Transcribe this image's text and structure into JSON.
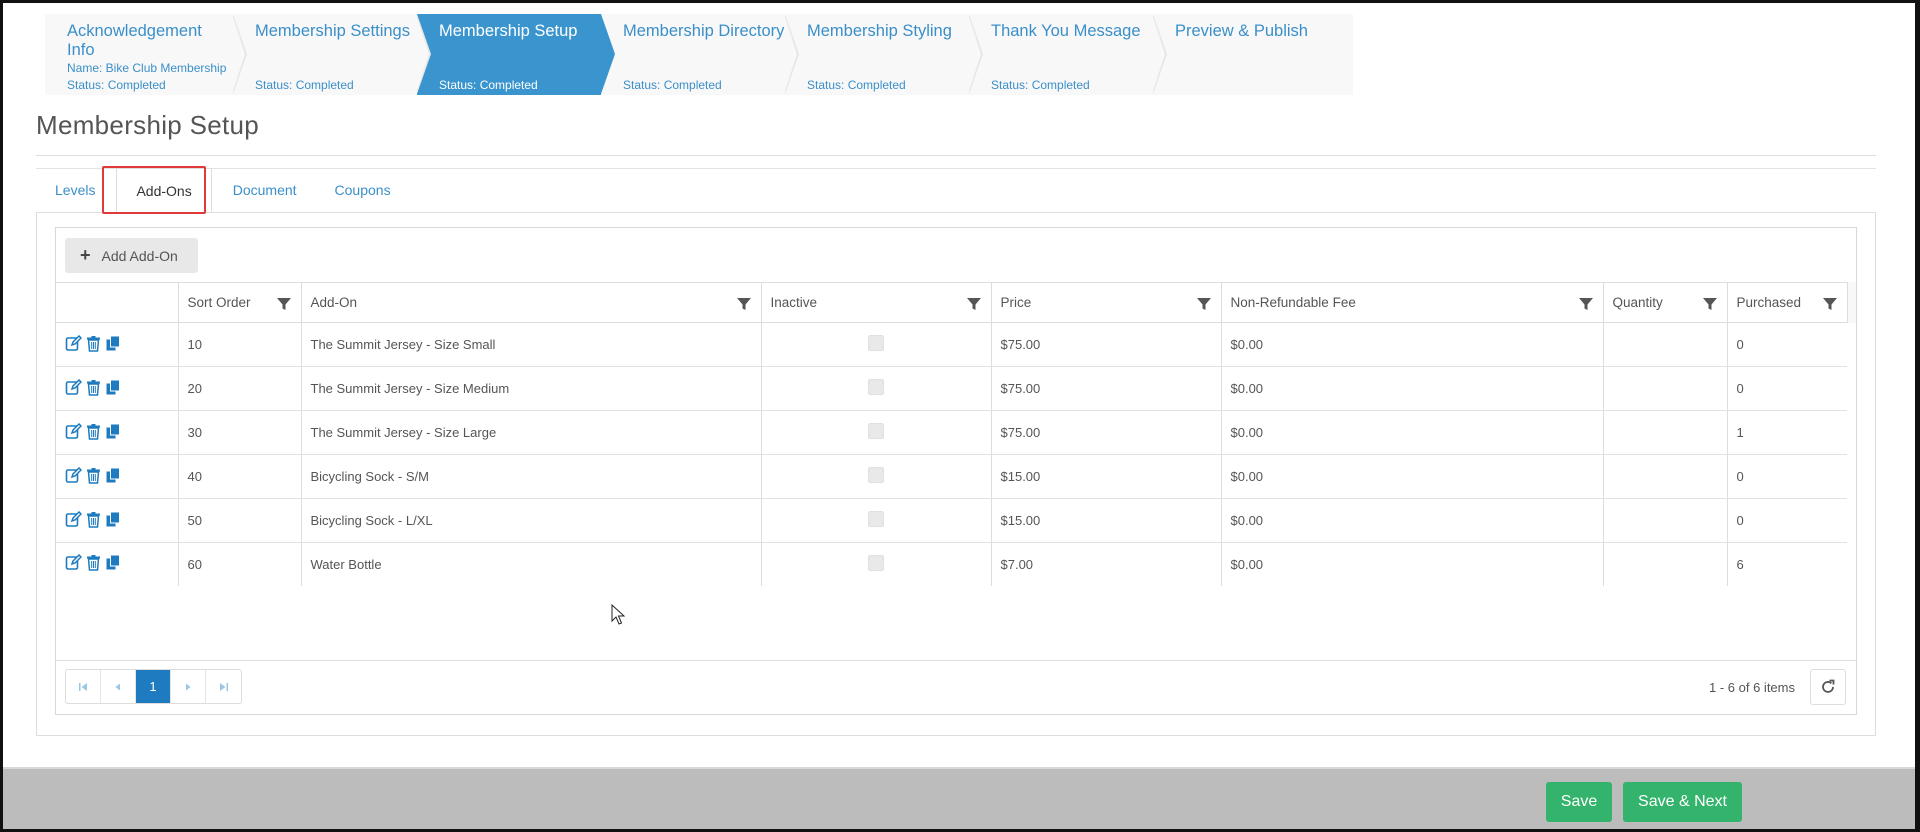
{
  "wizard": {
    "steps": [
      {
        "title": "Acknowledgement Info",
        "name": "Name: Bike Club Membership",
        "status": "Status: Completed",
        "active": false
      },
      {
        "title": "Membership Settings",
        "name": "",
        "status": "Status: Completed",
        "active": false
      },
      {
        "title": "Membership Setup",
        "name": "",
        "status": "Status: Completed",
        "active": true
      },
      {
        "title": "Membership Directory",
        "name": "",
        "status": "Status: Completed",
        "active": false
      },
      {
        "title": "Membership Styling",
        "name": "",
        "status": "Status: Completed",
        "active": false
      },
      {
        "title": "Thank You Message",
        "name": "",
        "status": "Status: Completed",
        "active": false
      },
      {
        "title": "Preview & Publish",
        "name": "",
        "status": "",
        "active": false
      }
    ]
  },
  "page": {
    "title": "Membership Setup"
  },
  "tabs": [
    {
      "label": "Levels",
      "active": false
    },
    {
      "label": "Add-Ons",
      "active": true
    },
    {
      "label": "Document",
      "active": false
    },
    {
      "label": "Coupons",
      "active": false
    }
  ],
  "toolbar": {
    "add_label": "Add Add-On",
    "add_icon": "plus-icon"
  },
  "grid": {
    "columns": [
      "",
      "Sort Order",
      "Add-On",
      "Inactive",
      "Price",
      "Non-Refundable Fee",
      "Quantity",
      "Purchased"
    ],
    "rows": [
      {
        "sort": "10",
        "addon": "The Summit Jersey - Size Small",
        "inactive": false,
        "price": "$75.00",
        "fee": "$0.00",
        "quantity": "",
        "purchased": "0"
      },
      {
        "sort": "20",
        "addon": "The Summit Jersey - Size Medium",
        "inactive": false,
        "price": "$75.00",
        "fee": "$0.00",
        "quantity": "",
        "purchased": "0"
      },
      {
        "sort": "30",
        "addon": "The Summit Jersey - Size Large",
        "inactive": false,
        "price": "$75.00",
        "fee": "$0.00",
        "quantity": "",
        "purchased": "1"
      },
      {
        "sort": "40",
        "addon": "Bicycling Sock - S/M",
        "inactive": false,
        "price": "$15.00",
        "fee": "$0.00",
        "quantity": "",
        "purchased": "0"
      },
      {
        "sort": "50",
        "addon": "Bicycling Sock - L/XL",
        "inactive": false,
        "price": "$15.00",
        "fee": "$0.00",
        "quantity": "",
        "purchased": "0"
      },
      {
        "sort": "60",
        "addon": "Water Bottle",
        "inactive": false,
        "price": "$7.00",
        "fee": "$0.00",
        "quantity": "",
        "purchased": "6"
      }
    ]
  },
  "pager": {
    "current_page": "1",
    "info": "1 - 6 of 6 items"
  },
  "footer": {
    "save_label": "Save",
    "save_next_label": "Save & Next"
  },
  "colors": {
    "accent": "#3a95cf",
    "link": "#3a8fc9",
    "save": "#33b36b",
    "highlight": "#e0393a"
  }
}
